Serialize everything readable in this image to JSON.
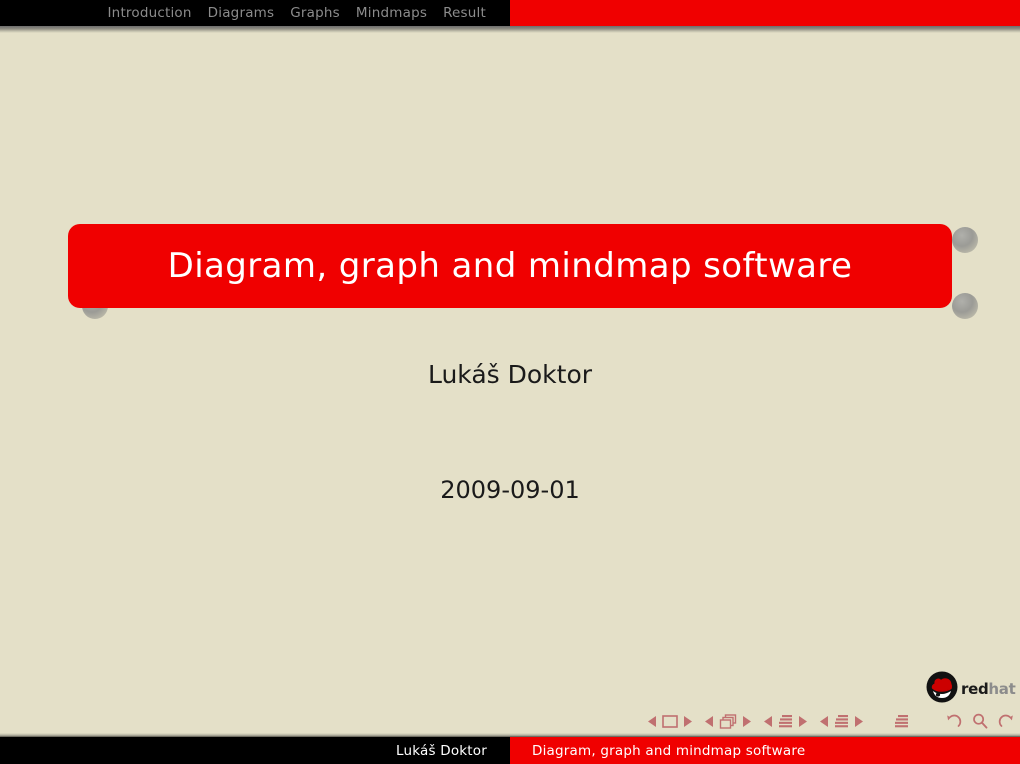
{
  "slide": {
    "background_color": "#e4e0c8",
    "accent_color": "#f00000",
    "nav": {
      "items": [
        {
          "label": "Introduction"
        },
        {
          "label": "Diagrams"
        },
        {
          "label": "Graphs"
        },
        {
          "label": "Mindmaps"
        },
        {
          "label": "Result"
        }
      ]
    },
    "title": "Diagram, graph and mindmap software",
    "author": "Lukáš Doktor",
    "date": "2009-09-01",
    "logo": {
      "icon": "redhat-shadowman-icon",
      "word_primary": "red",
      "word_secondary": "hat"
    },
    "navigation_symbols": [
      {
        "name": "slide-prev",
        "icon": "triangle-left-icon"
      },
      {
        "name": "slide-current",
        "icon": "square-outline-icon"
      },
      {
        "name": "slide-next",
        "icon": "triangle-right-icon"
      },
      {
        "name": "frame-prev",
        "icon": "triangle-left-icon"
      },
      {
        "name": "frame-current",
        "icon": "frames-stack-icon"
      },
      {
        "name": "frame-next",
        "icon": "triangle-right-icon"
      },
      {
        "name": "subsection-prev",
        "icon": "triangle-left-icon"
      },
      {
        "name": "subsection-current",
        "icon": "document-lines-icon"
      },
      {
        "name": "subsection-next",
        "icon": "triangle-right-icon"
      },
      {
        "name": "section-prev",
        "icon": "triangle-left-icon"
      },
      {
        "name": "section-current",
        "icon": "document-lines-icon"
      },
      {
        "name": "section-next",
        "icon": "triangle-right-icon"
      },
      {
        "name": "presentation",
        "icon": "document-lines-icon"
      },
      {
        "name": "go-back",
        "icon": "undo-arrow-icon"
      },
      {
        "name": "find",
        "icon": "magnifier-icon"
      },
      {
        "name": "go-forward",
        "icon": "redo-arrow-icon"
      }
    ],
    "footer": {
      "left_text": "Lukáš Doktor",
      "right_text": "Diagram, graph and mindmap software"
    }
  }
}
